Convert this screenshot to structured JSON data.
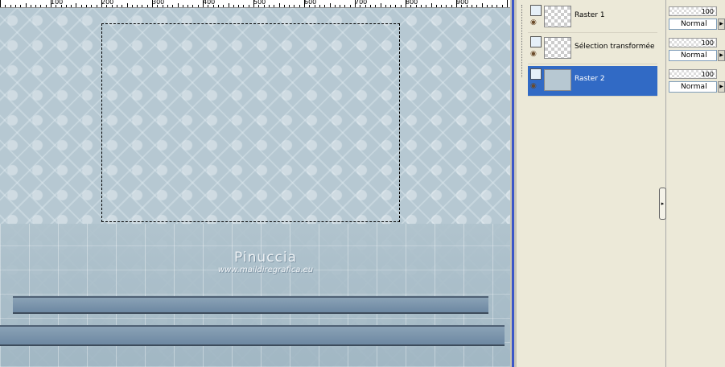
{
  "ruler": {
    "labels": [
      "100",
      "200",
      "300",
      "400",
      "500",
      "600",
      "700",
      "800",
      "900"
    ]
  },
  "watermark": {
    "name": "Pinuccia",
    "url": "www.maildiregrafica.eu"
  },
  "layers": [
    {
      "name": "Raster 1",
      "opacity": "100",
      "blend_mode": "Normal",
      "selected": false,
      "eye_icon": "eye-icon"
    },
    {
      "name": "Sélection transformée",
      "opacity": "100",
      "blend_mode": "Normal",
      "selected": false,
      "eye_icon": "eye-icon"
    },
    {
      "name": "Raster 2",
      "opacity": "100",
      "blend_mode": "Normal",
      "selected": true,
      "eye_icon": "eye-icon"
    }
  ],
  "colors": {
    "selection_highlight": "#316ac5",
    "canvas_bg": "#b7c8d2"
  }
}
